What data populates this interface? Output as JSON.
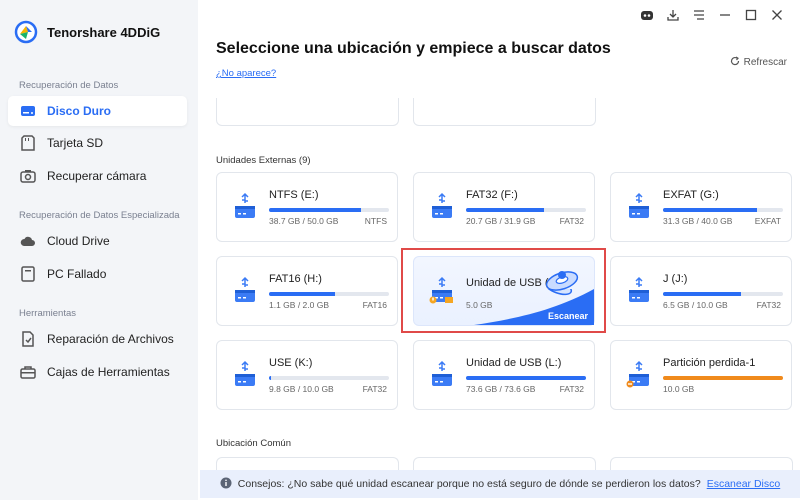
{
  "app": {
    "name": "Tenorshare 4DDiG"
  },
  "sidebar": {
    "sections": [
      {
        "title": "Recuperación de Datos"
      },
      {
        "title": "Recuperación de Datos Especializada"
      },
      {
        "title": "Herramientas"
      }
    ],
    "items": [
      {
        "label": "Disco Duro",
        "icon": "hard-drive-icon"
      },
      {
        "label": "Tarjeta SD",
        "icon": "sd-card-icon"
      },
      {
        "label": "Recuperar cámara",
        "icon": "camera-icon"
      },
      {
        "label": "Cloud Drive",
        "icon": "cloud-icon"
      },
      {
        "label": "PC Fallado",
        "icon": "pc-icon"
      },
      {
        "label": "Reparación de Archivos",
        "icon": "file-repair-icon"
      },
      {
        "label": "Cajas de Herramientas",
        "icon": "toolbox-icon"
      }
    ]
  },
  "main": {
    "title": "Seleccione una ubicación y empiece a buscar datos",
    "not_appear_link": "¿No aparece?",
    "refresh_label": "Refrescar",
    "external_title": "Unidades Externas (9)",
    "common_title": "Ubicación Común",
    "drives": [
      {
        "name": "NTFS (E:)",
        "size": "38.7 GB / 50.0 GB",
        "fs": "NTFS",
        "fill": 0.77
      },
      {
        "name": "FAT32 (F:)",
        "size": "20.7 GB / 31.9 GB",
        "fs": "FAT32",
        "fill": 0.65
      },
      {
        "name": "EXFAT (G:)",
        "size": "31.3 GB / 40.0 GB",
        "fs": "EXFAT",
        "fill": 0.78
      },
      {
        "name": "FAT16 (H:)",
        "size": "1.1 GB / 2.0 GB",
        "fs": "FAT16",
        "fill": 0.55
      },
      {
        "name": "Unidad de USB (I:)",
        "size": "5.0 GB",
        "fs": "",
        "fill": 0
      },
      {
        "name": "J (J:)",
        "size": "6.5 GB / 10.0 GB",
        "fs": "FAT32",
        "fill": 0.65
      },
      {
        "name": "USE (K:)",
        "size": "9.8 GB / 10.0 GB",
        "fs": "FAT32",
        "fill": 0.02
      },
      {
        "name": "Unidad de USB (L:)",
        "size": "73.6 GB / 73.6 GB",
        "fs": "FAT32",
        "fill": 1.0
      },
      {
        "name": "Partición perdida-1",
        "size": "10.0 GB",
        "fs": "",
        "fill": 1.0
      }
    ],
    "scan_button": "Escanear"
  },
  "tip": {
    "text": "Consejos: ¿No sabe qué unidad escanear porque no está seguro de dónde se perdieron los datos?",
    "link": "Escanear Disco"
  },
  "colors": {
    "accent": "#2a6df4",
    "lost_partition": "#f08a1c",
    "highlight": "#e04a48"
  }
}
